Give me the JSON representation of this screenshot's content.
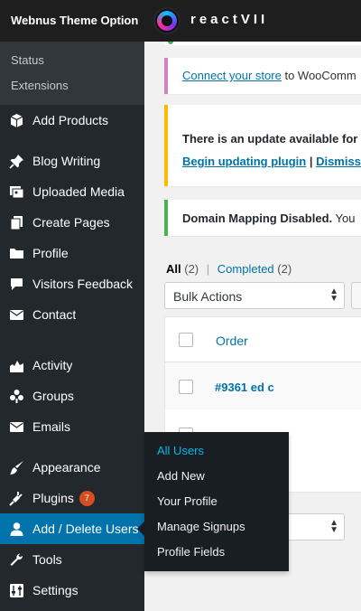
{
  "topbar": {
    "theme_option": "Webnus Theme Option",
    "brand": "reactVII"
  },
  "sidebar": {
    "sub_top": [
      "Status",
      "Extensions"
    ],
    "items": [
      {
        "label": "Add Products",
        "icon": "box-icon"
      },
      {
        "label": "Blog Writing",
        "icon": "pin-icon"
      },
      {
        "label": "Uploaded Media",
        "icon": "media-icon"
      },
      {
        "label": "Create Pages",
        "icon": "pages-icon"
      },
      {
        "label": "Profile",
        "icon": "folder-icon"
      },
      {
        "label": "Visitors Feedback",
        "icon": "comment-icon"
      },
      {
        "label": "Contact",
        "icon": "mail-icon"
      },
      {
        "label": "Activity",
        "icon": "activity-icon"
      },
      {
        "label": "Groups",
        "icon": "groups-icon"
      },
      {
        "label": "Emails",
        "icon": "mail-icon"
      },
      {
        "label": "Appearance",
        "icon": "brush-icon"
      },
      {
        "label": "Plugins",
        "icon": "plugin-icon",
        "badge": "7"
      },
      {
        "label": "Add / Delete Users",
        "icon": "user-icon",
        "active": true
      },
      {
        "label": "Tools",
        "icon": "wrench-icon"
      },
      {
        "label": "Settings",
        "icon": "settings-icon"
      }
    ]
  },
  "flyout": {
    "items": [
      "All Users",
      "Add New",
      "Your Profile",
      "Manage Signups",
      "Profile Fields"
    ],
    "current": "All Users"
  },
  "notices": {
    "woo_link": "Connect your store",
    "woo_rest": " to WooComm",
    "update_text": "There is an update available for",
    "update_link1": "Begin updating plugin",
    "update_sep": " | ",
    "update_link2": "Dismiss",
    "domain_bold": "Domain Mapping Disabled.",
    "domain_rest": " You"
  },
  "filters": {
    "all_label": "All",
    "all_count": "(2)",
    "separator": "|",
    "completed_label": "Completed",
    "completed_count": "(2)"
  },
  "bulk_actions": {
    "value": "Bulk Actions"
  },
  "table": {
    "column_order": "Order",
    "rows": [
      "#9361 ed c"
    ]
  },
  "colors": {
    "sidebar_bg": "#23282d",
    "active_bg": "#0073aa",
    "link": "#0073aa",
    "notice_pink": "#d183c4",
    "notice_yellow": "#ffba00",
    "notice_green": "#46b450",
    "badge": "#d54e21"
  }
}
